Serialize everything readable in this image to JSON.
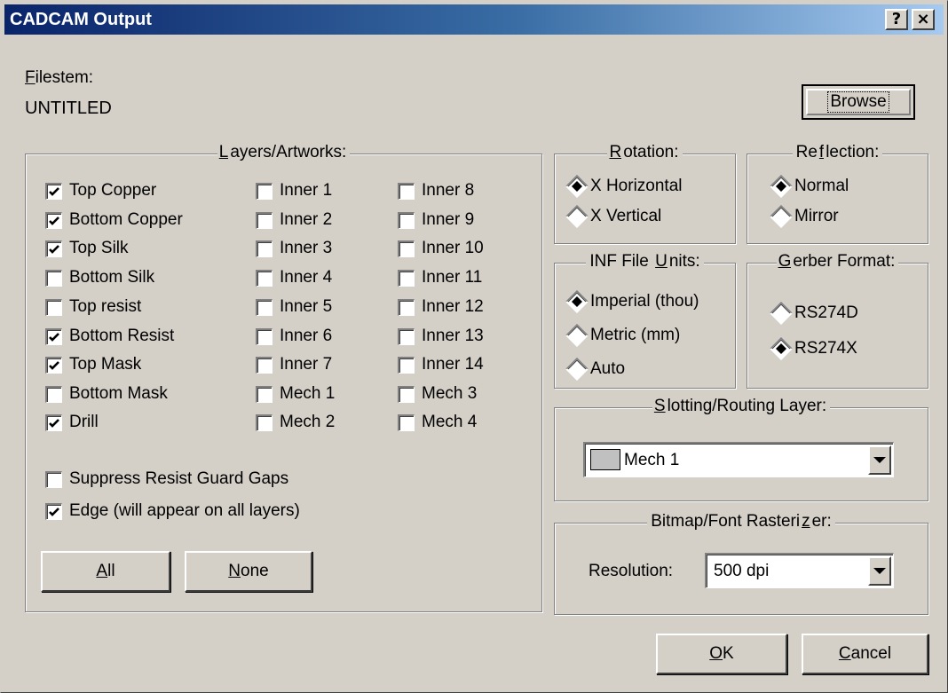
{
  "window": {
    "title": "CADCAM Output",
    "help_glyph": "?",
    "close_glyph": "×"
  },
  "filestem": {
    "label_accel": "F",
    "label_rest": "ilestem:",
    "value": "UNTITLED"
  },
  "browse_label": "Browse",
  "layers": {
    "title_accel": "L",
    "title_rest": "ayers/Artworks:",
    "col1": [
      {
        "label": "Top Copper",
        "checked": true
      },
      {
        "label": "Bottom Copper",
        "checked": true
      },
      {
        "label": "Top Silk",
        "checked": true
      },
      {
        "label": "Bottom Silk",
        "checked": false
      },
      {
        "label": "Top resist",
        "checked": false
      },
      {
        "label": "Bottom Resist",
        "checked": true
      },
      {
        "label": "Top Mask",
        "checked": true
      },
      {
        "label": "Bottom Mask",
        "checked": false
      },
      {
        "label": "Drill",
        "checked": true
      }
    ],
    "col2": [
      {
        "label": "Inner 1",
        "checked": false
      },
      {
        "label": "Inner 2",
        "checked": false
      },
      {
        "label": "Inner 3",
        "checked": false
      },
      {
        "label": "Inner 4",
        "checked": false
      },
      {
        "label": "Inner 5",
        "checked": false
      },
      {
        "label": "Inner 6",
        "checked": false
      },
      {
        "label": "Inner 7",
        "checked": false
      },
      {
        "label": "Mech 1",
        "checked": false
      },
      {
        "label": "Mech 2",
        "checked": false
      }
    ],
    "col3": [
      {
        "label": "Inner 8",
        "checked": false
      },
      {
        "label": "Inner 9",
        "checked": false
      },
      {
        "label": "Inner 10",
        "checked": false
      },
      {
        "label": "Inner 11",
        "checked": false
      },
      {
        "label": "Inner 12",
        "checked": false
      },
      {
        "label": "Inner 13",
        "checked": false
      },
      {
        "label": "Inner 14",
        "checked": false
      },
      {
        "label": "Mech 3",
        "checked": false
      },
      {
        "label": "Mech 4",
        "checked": false
      }
    ],
    "suppress": {
      "label": "Suppress Resist Guard Gaps",
      "checked": false
    },
    "edge": {
      "label": "Edge (will appear on all layers)",
      "checked": true
    },
    "all_accel": "A",
    "all_rest": "ll",
    "none_accel": "N",
    "none_rest": "one"
  },
  "rotation": {
    "title_accel": "R",
    "title_rest": "otation:",
    "options": [
      {
        "label": "X Horizontal",
        "selected": true
      },
      {
        "label": "X Vertical",
        "selected": false
      }
    ]
  },
  "reflection": {
    "title_pre": "Re",
    "title_accel": "f",
    "title_rest": "lection:",
    "options": [
      {
        "label": "Normal",
        "selected": true
      },
      {
        "label": "Mirror",
        "selected": false
      }
    ]
  },
  "inf_units": {
    "title_pre": "INF File ",
    "title_accel": "U",
    "title_rest": "nits:",
    "options": [
      {
        "label": "Imperial (thou)",
        "selected": true
      },
      {
        "label": "Metric (mm)",
        "selected": false
      },
      {
        "label": "Auto",
        "selected": false
      }
    ]
  },
  "gerber": {
    "title_accel": "G",
    "title_rest": "erber Format:",
    "options": [
      {
        "label": "RS274D",
        "selected": false
      },
      {
        "label": "RS274X",
        "selected": true
      }
    ]
  },
  "slotting": {
    "title_accel": "S",
    "title_rest": "lotting/Routing Layer:",
    "value": "Mech 1",
    "swatch_color": "#c0c0c0"
  },
  "bitmap": {
    "title_pre": "Bitmap/Font Rasteri",
    "title_accel": "z",
    "title_rest": "er:",
    "resolution_label": "Resolution:",
    "resolution_value": "500 dpi"
  },
  "ok_accel": "O",
  "ok_rest": "K",
  "cancel_accel": "C",
  "cancel_rest": "ancel"
}
